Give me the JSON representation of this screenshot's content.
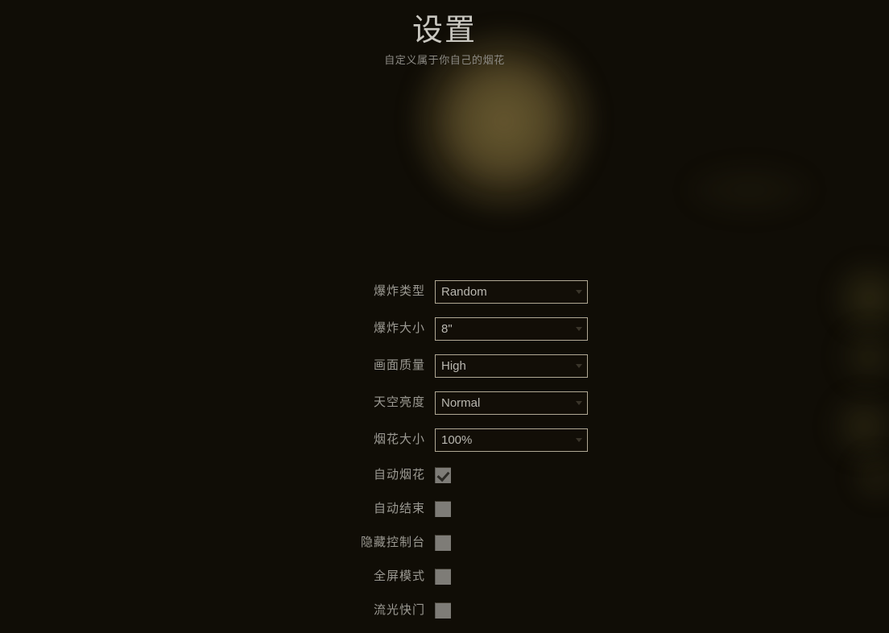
{
  "header": {
    "title": "设置",
    "subtitle": "自定义属于你自己的烟花"
  },
  "colors": {
    "background": "#100d06",
    "glow_core": "#5a4d2a",
    "title_text": "#c9c7c0",
    "label_text": "#9c9a93",
    "select_border": "#b0a894",
    "select_text": "#b9b7b0",
    "checkbox_fill": "#7e7c77",
    "checkmark": "#2c2a25"
  },
  "settings": {
    "selects": [
      {
        "label": "爆炸类型",
        "name": "explosion-type",
        "value": "Random",
        "options": [
          "Random"
        ]
      },
      {
        "label": "爆炸大小",
        "name": "explosion-size",
        "value": "8\"",
        "options": [
          "8\""
        ]
      },
      {
        "label": "画面质量",
        "name": "render-quality",
        "value": "High",
        "options": [
          "High"
        ]
      },
      {
        "label": "天空亮度",
        "name": "sky-brightness",
        "value": "Normal",
        "options": [
          "Normal"
        ]
      },
      {
        "label": "烟花大小",
        "name": "firework-scale",
        "value": "100%",
        "options": [
          "100%"
        ]
      }
    ],
    "checkboxes": [
      {
        "label": "自动烟花",
        "name": "auto-firework",
        "checked": true
      },
      {
        "label": "自动结束",
        "name": "auto-finale",
        "checked": false
      },
      {
        "label": "隐藏控制台",
        "name": "hide-console",
        "checked": false
      },
      {
        "label": "全屏模式",
        "name": "fullscreen-mode",
        "checked": false
      },
      {
        "label": "流光快门",
        "name": "long-exposure",
        "checked": false
      }
    ]
  }
}
